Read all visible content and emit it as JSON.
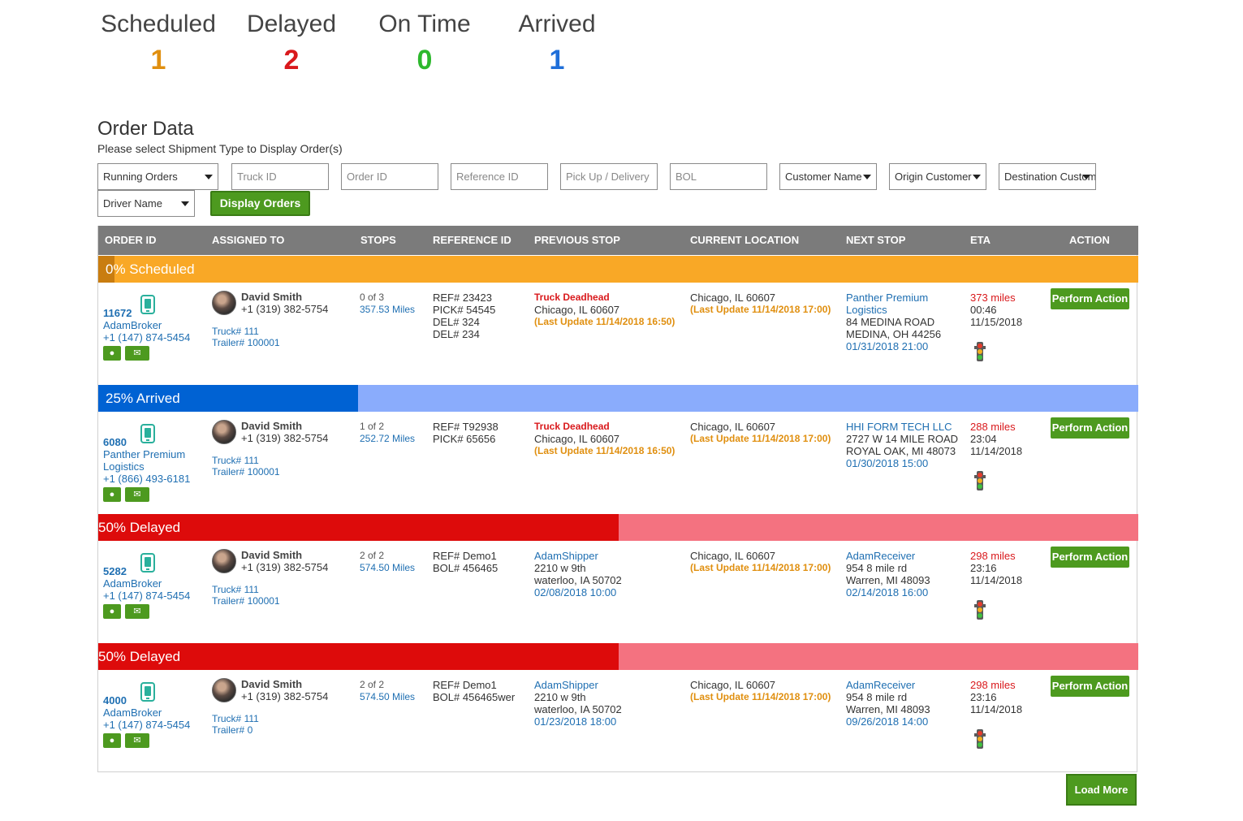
{
  "stats": [
    {
      "label": "Scheduled",
      "count": "1",
      "color": "#e08f0f"
    },
    {
      "label": "Delayed",
      "count": "2",
      "color": "#d9191c"
    },
    {
      "label": "On Time",
      "count": "0",
      "color": "#2db82d"
    },
    {
      "label": "Arrived",
      "count": "1",
      "color": "#1f6fd9"
    }
  ],
  "section": {
    "title": "Order Data",
    "subtitle": "Please select Shipment Type to Display Order(s)"
  },
  "filters": {
    "shipment_type": "Running Orders",
    "truck_id_placeholder": "Truck ID",
    "order_id_placeholder": "Order ID",
    "reference_id_placeholder": "Reference ID",
    "pickup_delivery_placeholder": "Pick Up / Delivery",
    "bol_placeholder": "BOL",
    "customer_name": "Customer Name",
    "origin_customer": "Origin Customer",
    "destination_customer": "Destination Custom",
    "driver_name": "Driver Name",
    "display_button": "Display Orders"
  },
  "table_headers": [
    "ORDER ID",
    "ASSIGNED TO",
    "STOPS",
    "REFERENCE ID",
    "PREVIOUS STOP",
    "CURRENT LOCATION",
    "NEXT STOP",
    "ETA",
    "ACTION"
  ],
  "orders": [
    {
      "band": {
        "label": "0% Scheduled",
        "progress": 0.0,
        "fill_color": "#c97d10",
        "bg_color": "#f9a826"
      },
      "order_id": "11672",
      "customer_lines": [
        "AdamBroker"
      ],
      "customer_phone": "+1 (147) 874-5454",
      "driver": "David Smith",
      "driver_phone": "+1 (319) 382-5754",
      "truck": "Truck# 111",
      "trailer": "Trailer# 100001",
      "stops": "0 of 3",
      "miles": "357.53 Miles",
      "refs": [
        "REF# 23423",
        "PICK# 54545",
        "DEL# 324",
        "DEL# 234"
      ],
      "prev": {
        "title": "Truck Deadhead",
        "title_type": "red",
        "lines": [
          "Chicago, IL 60607"
        ],
        "date": "",
        "update": "(Last Update 11/14/2018 16:50)"
      },
      "current": {
        "location": "Chicago, IL 60607",
        "update": "(Last Update 11/14/2018 17:00)"
      },
      "next": {
        "name_lines": [
          "Panther Premium",
          "Logistics"
        ],
        "address_lines": [
          "84 MEDINA ROAD",
          "MEDINA, OH 44256"
        ],
        "date": "01/31/2018 21:00"
      },
      "eta": {
        "miles": "373 miles",
        "time": "00:46",
        "date": "11/15/2018"
      },
      "action": "Perform Action"
    },
    {
      "band": {
        "label": "25% Arrived",
        "progress": 0.25,
        "fill_color": "#0062d3",
        "bg_color": "#8aacfc"
      },
      "order_id": "6080",
      "customer_lines": [
        "Panther Premium",
        "Logistics"
      ],
      "customer_phone": "+1 (866) 493-6181",
      "driver": "David Smith",
      "driver_phone": "+1 (319) 382-5754",
      "truck": "Truck# 111",
      "trailer": "Trailer# 100001",
      "stops": "1 of 2",
      "miles": "252.72 Miles",
      "refs": [
        "REF# T92938",
        "PICK# 65656"
      ],
      "prev": {
        "title": "Truck Deadhead",
        "title_type": "red",
        "lines": [
          "Chicago, IL 60607"
        ],
        "date": "",
        "update": "(Last Update 11/14/2018 16:50)"
      },
      "current": {
        "location": "Chicago, IL 60607",
        "update": "(Last Update 11/14/2018 17:00)"
      },
      "next": {
        "name_lines": [
          "HHI FORM TECH LLC"
        ],
        "address_lines": [
          "2727 W 14 MILE ROAD",
          "ROYAL OAK, MI 48073"
        ],
        "date": "01/30/2018 15:00"
      },
      "eta": {
        "miles": "288 miles",
        "time": "23:04",
        "date": "11/14/2018"
      },
      "action": "Perform Action"
    },
    {
      "band": {
        "label": "50% Delayed",
        "progress": 0.5,
        "fill_color": "#dd0b0b",
        "bg_color": "#f47280"
      },
      "order_id": "5282",
      "customer_lines": [
        "AdamBroker"
      ],
      "customer_phone": "+1 (147) 874-5454",
      "driver": "David Smith",
      "driver_phone": "+1 (319) 382-5754",
      "truck": "Truck# 111",
      "trailer": "Trailer# 100001",
      "stops": "2 of 2",
      "miles": "574.50 Miles",
      "refs": [
        "REF# Demo1",
        "BOL# 456465"
      ],
      "prev": {
        "title": "AdamShipper",
        "title_type": "blue",
        "lines": [
          "2210 w 9th",
          "waterloo, IA 50702"
        ],
        "date": "02/08/2018 10:00",
        "update": ""
      },
      "current": {
        "location": "Chicago, IL 60607",
        "update": "(Last Update 11/14/2018 17:00)"
      },
      "next": {
        "name_lines": [
          "AdamReceiver"
        ],
        "address_lines": [
          "954 8 mile rd",
          "Warren, MI 48093"
        ],
        "date": "02/14/2018 16:00"
      },
      "eta": {
        "miles": "298 miles",
        "time": "23:16",
        "date": "11/14/2018"
      },
      "action": "Perform Action"
    },
    {
      "band": {
        "label": "50% Delayed",
        "progress": 0.5,
        "fill_color": "#dd0b0b",
        "bg_color": "#f47280"
      },
      "order_id": "4000",
      "customer_lines": [
        "AdamBroker"
      ],
      "customer_phone": "+1 (147) 874-5454",
      "driver": "David Smith",
      "driver_phone": "+1 (319) 382-5754",
      "truck": "Truck# 111",
      "trailer": "Trailer# 0",
      "stops": "2 of 2",
      "miles": "574.50 Miles",
      "refs": [
        "REF# Demo1",
        "BOL# 456465wer"
      ],
      "prev": {
        "title": "AdamShipper",
        "title_type": "blue",
        "lines": [
          "2210 w 9th",
          "waterloo, IA 50702"
        ],
        "date": "01/23/2018 18:00",
        "update": ""
      },
      "current": {
        "location": "Chicago, IL 60607",
        "update": "(Last Update 11/14/2018 17:00)"
      },
      "next": {
        "name_lines": [
          "AdamReceiver"
        ],
        "address_lines": [
          "954 8 mile rd",
          "Warren, MI 48093"
        ],
        "date": "09/26/2018 14:00"
      },
      "eta": {
        "miles": "298 miles",
        "time": "23:16",
        "date": "11/14/2018"
      },
      "action": "Perform Action"
    }
  ],
  "load_more": "Load More",
  "icons": {
    "phone": "phone-icon",
    "location": "location-pin-icon",
    "message": "envelope-icon",
    "traffic": "traffic-light-icon"
  }
}
